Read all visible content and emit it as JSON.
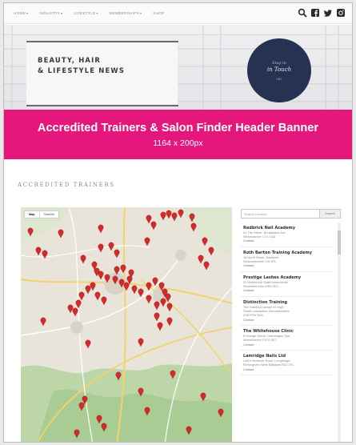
{
  "nav": {
    "items": [
      {
        "label": "HOME"
      },
      {
        "label": "INDUSTRY"
      },
      {
        "label": "LIFESTYLE"
      },
      {
        "label": "MEMBERSHIPS"
      },
      {
        "label": "SHOP"
      }
    ],
    "icons": [
      "search-icon",
      "facebook-icon",
      "twitter-icon",
      "instagram-icon"
    ]
  },
  "hero": {
    "title_line1": "BEAUTY, HAIR",
    "title_line2": "& LIFESTYLE NEWS",
    "logo_line1": "Stay in",
    "logo_line2": "in Touch",
    "logo_line3": "HBT"
  },
  "banner": {
    "title": "Accredited Trainers & Salon Finder Header Banner",
    "size": "1164 x 200px",
    "color": "#e5177c"
  },
  "section": {
    "title": "ACCREDITED TRAINERS"
  },
  "map": {
    "tabs": [
      {
        "label": "Map",
        "active": true
      },
      {
        "label": "Satellite",
        "active": false
      }
    ],
    "marker_color": "#d42a2a"
  },
  "listing": {
    "search_placeholder": "Search Location",
    "search_button": "Search",
    "results": [
      {
        "name": "Redbrick Nail Academy",
        "lines": [
          "61 The Street, Broadstairs Ave",
          "Warwickshire CV1 1AA"
        ],
        "link": "Contact"
      },
      {
        "name": "Roth Barton Training Academy",
        "lines": [
          "16 North Street, Nantwich",
          "Worcestershire CW 6TL"
        ],
        "link": "Contact"
      },
      {
        "name": "Prestige Lashes Academy",
        "lines": [
          "22 Westbrook Road Morecombe",
          "Worcestershire WR4 9DJ"
        ],
        "link": "Contact"
      },
      {
        "name": "Distinction Training",
        "lines": [
          "The Training Lounge 44 High",
          "Street Lancashire Worcestershire",
          "LN5 9TW 6AA"
        ],
        "link": "Contact"
      },
      {
        "name": "The Whitehouse Clinic",
        "lines": [
          "8 Orange Street, Leamington Spa",
          "Warwickshire CV32 5EJ"
        ],
        "link": "Contact"
      },
      {
        "name": "Lamridge Nails Ltd",
        "lines": [
          "Unit 6 Mortimer Road, Longbridge",
          "Birmingham West Midlands B31 2XL"
        ],
        "link": "Contact"
      }
    ]
  }
}
